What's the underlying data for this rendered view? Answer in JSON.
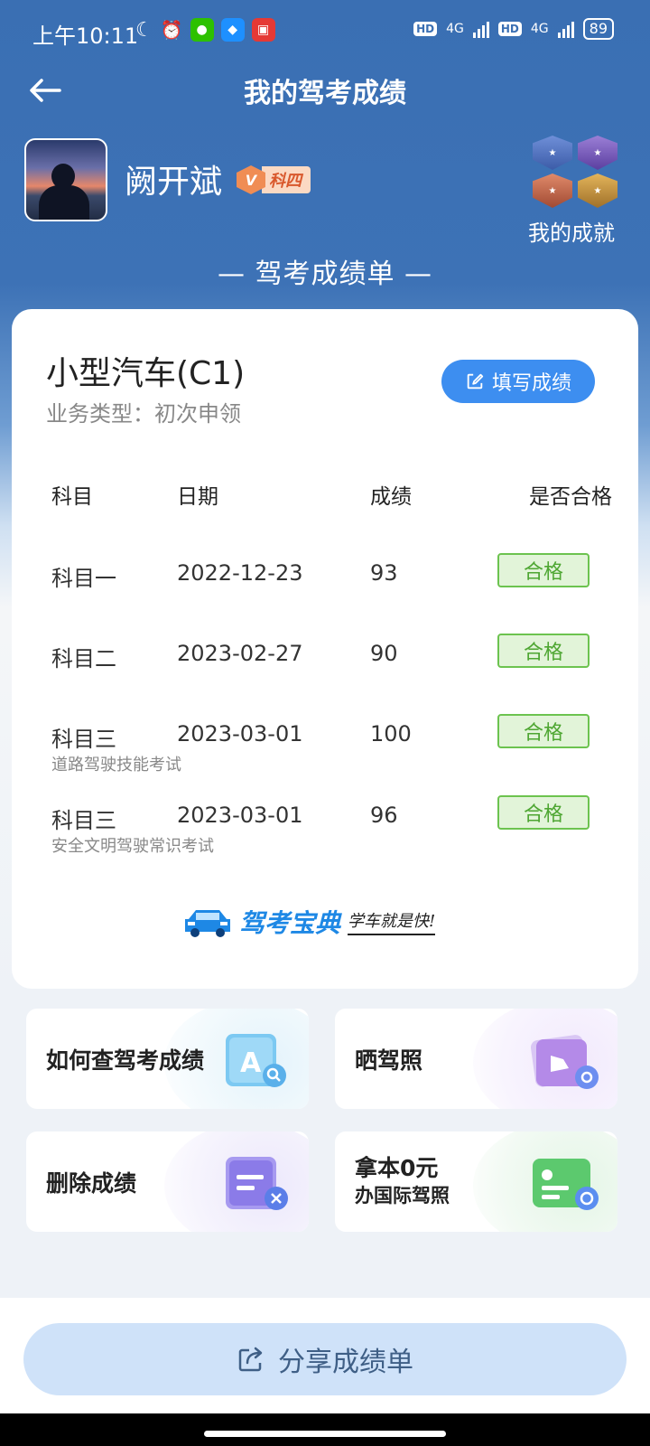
{
  "status_bar": {
    "time": "上午10:11",
    "network1": "4G",
    "network2": "4G",
    "hd": "HD",
    "battery": "89"
  },
  "header": {
    "title": "我的驾考成绩"
  },
  "profile": {
    "username": "阙开斌",
    "level_badge": "科四",
    "level_badge_v": "V",
    "achievements_label": "我的成就"
  },
  "sheet_title": "— 驾考成绩单 —",
  "card": {
    "vehicle_type": "小型汽车(C1)",
    "business_type": "业务类型：初次申领",
    "fill_button": "填写成绩",
    "columns": [
      "科目",
      "日期",
      "成绩",
      "是否合格"
    ],
    "rows": [
      {
        "subject": "科目一",
        "date": "2022-12-23",
        "score": "93",
        "result": "合格",
        "note": ""
      },
      {
        "subject": "科目二",
        "date": "2023-02-27",
        "score": "90",
        "result": "合格",
        "note": ""
      },
      {
        "subject": "科目三",
        "date": "2023-03-01",
        "score": "100",
        "result": "合格",
        "note": "道路驾驶技能考试"
      },
      {
        "subject": "科目三",
        "date": "2023-03-01",
        "score": "96",
        "result": "合格",
        "note": "安全文明驾驶常识考试"
      }
    ],
    "brand_name": "驾考宝典",
    "brand_slogan": "学车就是快!"
  },
  "tiles": {
    "query": "如何查驾考成绩",
    "show_license": "晒驾照",
    "delete": "删除成绩",
    "intl_line1": "拿本0元",
    "intl_line2": "办国际驾照"
  },
  "share_button": "分享成绩单",
  "colors": {
    "header_blue": "#3a6fb3",
    "accent_blue": "#3d8ef0",
    "pass_green": "#4ea632",
    "share_bg": "#cfe2f9"
  }
}
